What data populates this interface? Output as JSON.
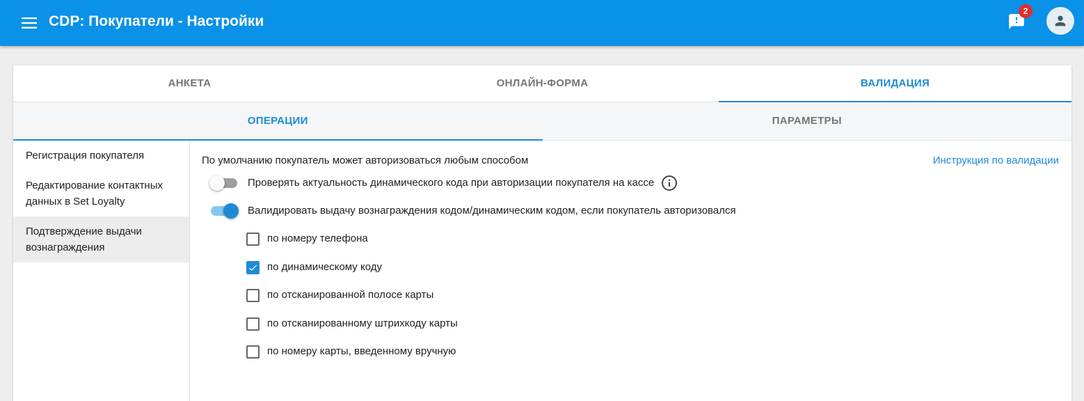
{
  "header": {
    "title": "CDP: Покупатели - Настройки",
    "notification_count": "2",
    "menu_icon": "menu-icon",
    "notification_icon": "feedback-icon",
    "avatar_icon": "account-icon"
  },
  "tabs": [
    {
      "label": "АНКЕТА",
      "active": false
    },
    {
      "label": "ОНЛАЙН-ФОРМА",
      "active": false
    },
    {
      "label": "ВАЛИДАЦИЯ",
      "active": true
    }
  ],
  "subtabs": [
    {
      "label": "ОПЕРАЦИИ",
      "active": true
    },
    {
      "label": "ПАРАМЕТРЫ",
      "active": false
    }
  ],
  "sidebar": {
    "items": [
      {
        "label": "Регистрация покупателя",
        "selected": false
      },
      {
        "label": "Редактирование контактных данных в Set Loyalty",
        "selected": false
      },
      {
        "label": "Подтверждение выдачи вознаграждения",
        "selected": true
      }
    ]
  },
  "main": {
    "default_text": "По умолчанию покупатель может авторизоваться любым способом",
    "help_link": "Инструкция по валидации",
    "toggles": [
      {
        "label": "Проверять актуальность динамического кода при авторизации покупателя на кассе",
        "on": false
      },
      {
        "label": "Валидировать выдачу вознаграждения кодом/динамическим кодом, если покупатель авторизовался",
        "on": true
      }
    ],
    "options": [
      {
        "label": "по номеру телефона",
        "checked": false
      },
      {
        "label": "по динамическому коду",
        "checked": true
      },
      {
        "label": "по отсканированной полосе карты",
        "checked": false
      },
      {
        "label": "по отсканированному штрихкоду карты",
        "checked": false
      },
      {
        "label": "по номеру карты, введенному вручную",
        "checked": false
      }
    ]
  },
  "colors": {
    "appbar": "#0a91e8",
    "accent": "#1e8ad6",
    "badge": "#e0302b"
  }
}
